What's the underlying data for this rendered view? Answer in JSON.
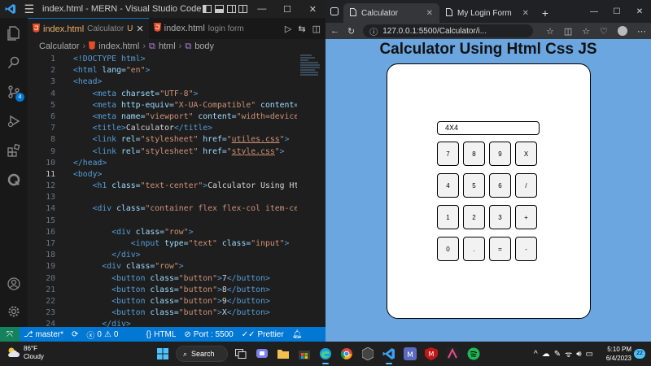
{
  "vscode": {
    "title": "index.html - MERN - Visual Studio Code",
    "tabs": [
      {
        "file": "index.html",
        "desc": "Calculator",
        "modified": "U"
      },
      {
        "file": "index.html",
        "desc": "login form"
      }
    ],
    "breadcrumb": [
      "Calculator",
      "index.html",
      "html",
      "body"
    ],
    "scm_badge": "4",
    "code_lines": [
      {
        "n": "1"
      },
      {
        "n": "2"
      },
      {
        "n": "3"
      },
      {
        "n": "4"
      },
      {
        "n": "5"
      },
      {
        "n": "6"
      },
      {
        "n": "7"
      },
      {
        "n": "8"
      },
      {
        "n": "9"
      },
      {
        "n": "10"
      },
      {
        "n": "11"
      },
      {
        "n": "12"
      },
      {
        "n": "13"
      },
      {
        "n": "14"
      },
      {
        "n": "15"
      },
      {
        "n": "16"
      },
      {
        "n": "17"
      },
      {
        "n": "18"
      },
      {
        "n": "19"
      },
      {
        "n": "20"
      },
      {
        "n": "21"
      },
      {
        "n": "22"
      },
      {
        "n": "23"
      },
      {
        "n": "24"
      }
    ],
    "code": {
      "l1": "<!DOCTYPE html>",
      "l2a": "<html",
      "l2b": " lang=",
      "l2c": "\"en\"",
      "l2d": ">",
      "l3": "<head>",
      "l4a": "<meta",
      "l4b": " charset=",
      "l4c": "\"UTF-8\"",
      "l4d": ">",
      "l5a": "<meta",
      "l5b": " http-equiv=",
      "l5c": "\"X-UA-Compatible\"",
      "l5d": " content=\"",
      "l6a": "<meta",
      "l6b": " name=",
      "l6c": "\"viewport\"",
      "l6d": " content=",
      "l6e": "\"width=device-",
      "l7a": "<title>",
      "l7b": "Calculator",
      "l7c": "</title>",
      "l8a": "<link",
      "l8b": " rel=",
      "l8c": "\"stylesheet\"",
      "l8d": " href=",
      "l8e": "\"",
      "l8f": "utiles.css",
      "l8g": "\"",
      "l8h": ">",
      "l9a": "<link",
      "l9b": " rel=",
      "l9c": "\"stylesheet\"",
      "l9d": " href=",
      "l9e": "\"",
      "l9f": "style.css",
      "l9g": "\"",
      "l9h": ">",
      "l10": "</head>",
      "l11": "<body>",
      "l12a": "<h1",
      "l12b": " class=",
      "l12c": "\"text-center\"",
      "l12d": ">",
      "l12e": "Calculator Using Html",
      "l13": "",
      "l14a": "<div",
      "l14b": " class=",
      "l14c": "\"container flex flex-col item-cen",
      "l15": "",
      "l16a": "<div",
      "l16b": " class=",
      "l16c": "\"row\"",
      "l16d": ">",
      "l17a": "<input",
      "l17b": " type=",
      "l17c": "\"text\"",
      "l17d": " class=",
      "l17e": "\"input\"",
      "l17f": ">",
      "l18": "</div>",
      "l19a": "<div",
      "l19b": " class=",
      "l19c": "\"row\"",
      "l19d": ">",
      "l20a": "<button",
      "l20b": " class=",
      "l20c": "\"button\"",
      "l20d": ">",
      "l20e": "7",
      "l20f": "</button>",
      "l21a": "<button",
      "l21b": " class=",
      "l21c": "\"button\"",
      "l21d": ">",
      "l21e": "8",
      "l21f": "</button>",
      "l22a": "<button",
      "l22b": " class=",
      "l22c": "\"button\"",
      "l22d": ">",
      "l22e": "9",
      "l22f": "</button>",
      "l23a": "<button",
      "l23b": " class=",
      "l23c": "\"button\"",
      "l23d": ">",
      "l23e": "X",
      "l23f": "</button>",
      "l24": "</div>"
    },
    "status": {
      "branch": "master*",
      "errors": "0",
      "warnings": "0",
      "language": "HTML",
      "port": "Port : 5500",
      "prettier": "Prettier"
    }
  },
  "browser": {
    "tabs": [
      {
        "label": "Calculator"
      },
      {
        "label": "My Login Form"
      }
    ],
    "url": "127.0.0.1:5500/Calculator/i...",
    "page": {
      "heading": "Calculator Using Html Css JS",
      "display_value": "4X4",
      "buttons": [
        "7",
        "8",
        "9",
        "X",
        "4",
        "5",
        "6",
        "/",
        "1",
        "2",
        "3",
        "+",
        "0",
        ".",
        "=",
        "-"
      ]
    }
  },
  "taskbar": {
    "weather_temp": "86°F",
    "weather_desc": "Cloudy",
    "search_label": "Search",
    "time": "5:10 PM",
    "date": "6/4/2023",
    "notification_count": "22"
  },
  "colors": {
    "vscode_accent": "#0078d4",
    "browser_page_bg": "#6ba6e0",
    "html_file_icon": "#e44d26"
  }
}
